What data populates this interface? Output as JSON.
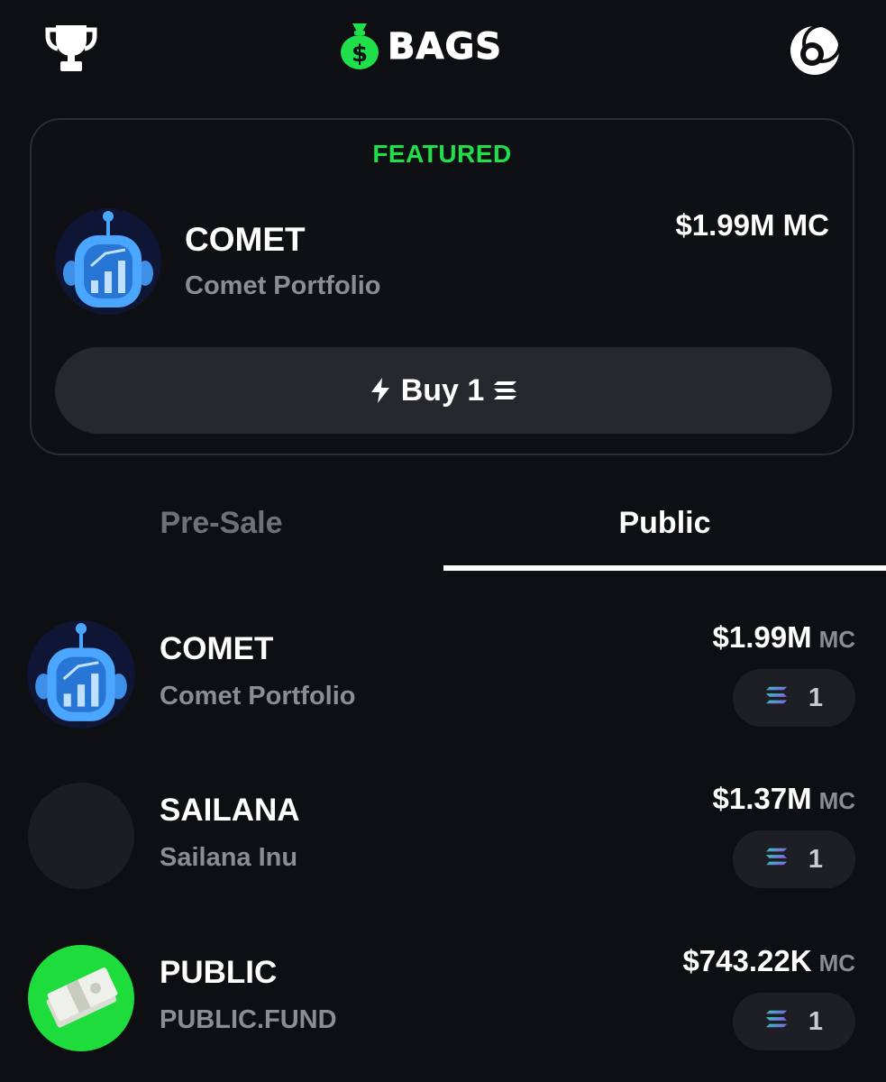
{
  "header": {
    "logo_text": "BAGS",
    "logo_bag_symbol": "$",
    "icons": [
      "trophy-icon",
      "money-bag-icon",
      "profile-icon"
    ]
  },
  "featured": {
    "label": "FEATURED",
    "ticker": "COMET",
    "name": "Comet Portfolio",
    "market_cap": "$1.99M MC",
    "buy_label": "Buy 1",
    "buy_icons": [
      "lightning-icon",
      "solana-icon"
    ]
  },
  "tabs": {
    "presale": "Pre-Sale",
    "public": "Public",
    "selected": "Public"
  },
  "tokens": [
    {
      "ticker": "COMET",
      "name": "Comet Portfolio",
      "market_cap": "$1.99M",
      "mc_suffix": "MC",
      "amount": "1",
      "avatar": "comet-robot-icon"
    },
    {
      "ticker": "SAILANA",
      "name": "Sailana Inu",
      "market_cap": "$1.37M",
      "mc_suffix": "MC",
      "amount": "1",
      "avatar": "blank-avatar"
    },
    {
      "ticker": "PUBLIC",
      "name": "PUBLIC.FUND",
      "market_cap": "$743.22K",
      "mc_suffix": "MC",
      "amount": "1",
      "avatar": "money-stack-icon"
    }
  ],
  "colors": {
    "background": "#0d0f12",
    "accent_green": "#1fe04a",
    "muted_text": "#8a8d93",
    "button_bg": "#26282d"
  }
}
